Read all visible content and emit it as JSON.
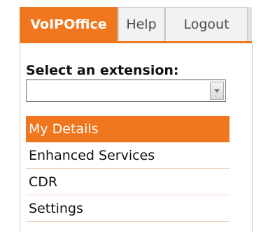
{
  "tabs": {
    "voipoffice": "VoIPOffice",
    "help": "Help",
    "logout": "Logout"
  },
  "extension": {
    "label": "Select an extension:",
    "selected": ""
  },
  "menu": {
    "items": [
      {
        "label": "My Details",
        "active": true
      },
      {
        "label": "Enhanced Services",
        "active": false
      },
      {
        "label": "CDR",
        "active": false
      },
      {
        "label": "Settings",
        "active": false
      }
    ]
  },
  "colors": {
    "accent": "#f0771e",
    "divider": "#f4d3bd",
    "tab_bg": "#f2f2f2"
  },
  "icons": {
    "dropdown": "chevron-down-icon"
  }
}
